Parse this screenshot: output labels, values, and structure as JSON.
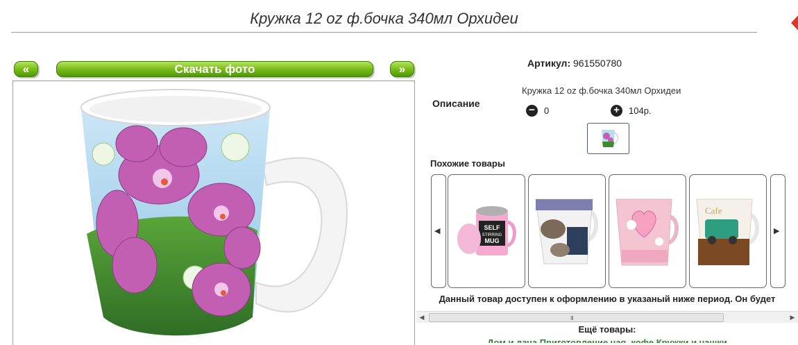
{
  "page": {
    "title": "Кружка 12 oz ф.бочка 340мл Орхидеи"
  },
  "photo_nav": {
    "prev_label": "«",
    "download_label": "Скачать фото",
    "next_label": "»"
  },
  "product": {
    "article_label": "Артикул:",
    "article_value": "961550780",
    "description_label": "Описание",
    "description_text": "Кружка 12 oz ф.бочка 340мл Орхидеи",
    "quantity": "0",
    "price": "104р."
  },
  "similar": {
    "title": "Похожие товары",
    "prev_glyph": "◀",
    "next_glyph": "▶",
    "items": [
      {
        "caption": "SELF STIRRING MUG"
      },
      {
        "caption": ""
      },
      {
        "caption": ""
      },
      {
        "caption": ""
      }
    ]
  },
  "notice": "Данный товар доступен к оформлению в указаный ниже период. Он будет",
  "scrollbar": {
    "grip": "III"
  },
  "more": {
    "title": "Ещё товары:",
    "categories": "Дом и дача    Приготовление чая, кофе    Кружки и чашки"
  },
  "colors": {
    "accent_green": "#6db516",
    "link_green": "#1f8a1f",
    "orchid": "#c25fb3"
  }
}
